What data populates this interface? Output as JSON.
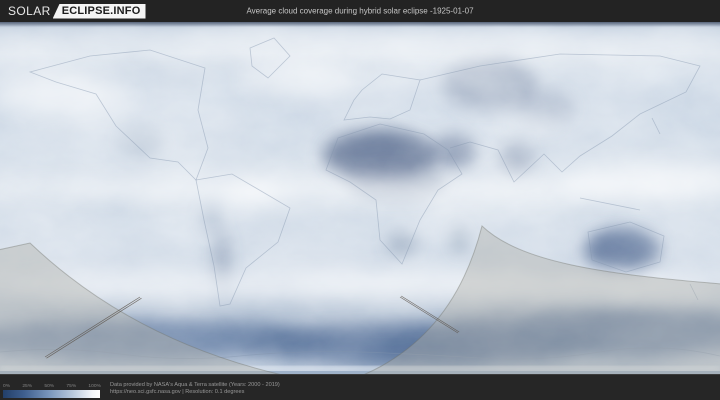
{
  "header": {
    "logo_part1": "SOLAR",
    "logo_part2": "ECLIPSE.INFO",
    "title": "Average cloud coverage during hybrid solar eclipse -1925-01-07"
  },
  "map": {
    "kind": "world-cloud-coverage-map",
    "overlay": "eclipse-visibility-shadow-region",
    "colors": {
      "clear_sky": "#4d6187",
      "cloudy": "#ffffff",
      "ocean_base": "#cfdbe8",
      "eclipse_overlay": "rgba(176,176,169,0.42)"
    }
  },
  "footer": {
    "scale_labels": [
      "0%",
      "25%",
      "50%",
      "75%",
      "100%"
    ],
    "attribution_line1": "Data provided by NASA's Aqua & Terra satellite (Years: 2000 - 2019)",
    "attribution_line2": "https://neo.sci.gsfc.nasa.gov | Resolution: 0.1 degrees"
  },
  "colors": {
    "header_bg": "#232323",
    "footer_bg": "#262626",
    "scale_start": "#223f69",
    "scale_end": "#ffffff"
  }
}
